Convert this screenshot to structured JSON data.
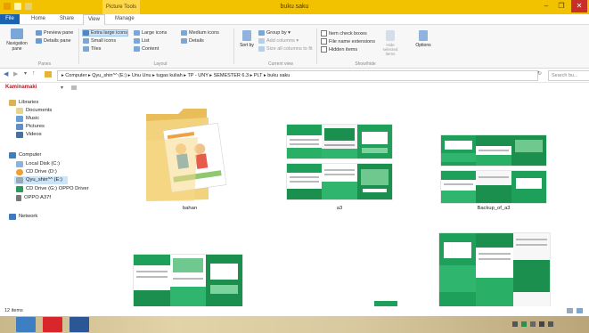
{
  "window": {
    "title": "buku saku",
    "contextual_tab": "Picture Tools",
    "min_label": "–",
    "max_label": "❐",
    "close_label": "✕"
  },
  "tabs": [
    "File",
    "Home",
    "Share",
    "View",
    "Manage"
  ],
  "ribbon": {
    "navigation_pane": "Navigation pane",
    "preview_pane": "Preview pane",
    "details_pane": "Details pane",
    "panes_label": "Panes",
    "extra_large": "Extra large icons",
    "large": "Large icons",
    "medium": "Medium icons",
    "small": "Small icons",
    "list": "List",
    "details": "Details",
    "tiles": "Tiles",
    "content": "Content",
    "layout_label": "Layout",
    "sort_by": "Sort by",
    "group_by": "Group by ▾",
    "add_columns": "Add columns ▾",
    "size_columns": "Size all columns to fit",
    "current_view_label": "Current view",
    "item_check_boxes": "Item check boxes",
    "file_name_extensions": "File name extensions",
    "hidden_items": "Hidden items",
    "hide_selected": "Hide selected items",
    "show_hide_label": "Show/hide",
    "options": "Options"
  },
  "address": {
    "path": "▸ Computer ▸ Qyu_shin^^ (E:) ▸ Unu Unu ▸ tugas kuliah ▸ TP - UNY ▸ SEMESTER 6.3 ▸ PLT ▸ buku saku",
    "search_placeholder": "Search bu..."
  },
  "toolbar": {
    "brand": "Kaminamaki"
  },
  "nav": {
    "libraries": "Libraries",
    "documents": "Documents",
    "music": "Music",
    "pictures": "Pictures",
    "videos": "Videos",
    "computer": "Computer",
    "local_disk": "Local Disk (C:)",
    "cd_drive_d": "CD Drive (D:)",
    "qyu_shin": "Qyu_shin^^ (E:)",
    "cd_drive_g": "CD Drive (G:) OPPO Driver",
    "oppo": "OPPO A37f",
    "network": "Network"
  },
  "files": [
    {
      "name": "bahan"
    },
    {
      "name": "a3"
    },
    {
      "name": "Backup_of_a3"
    }
  ],
  "status": {
    "items": "12 items"
  },
  "colors": {
    "accent": "#f2c100",
    "brochure_green": "#1fa05a",
    "file_tab": "#1b63b0"
  }
}
